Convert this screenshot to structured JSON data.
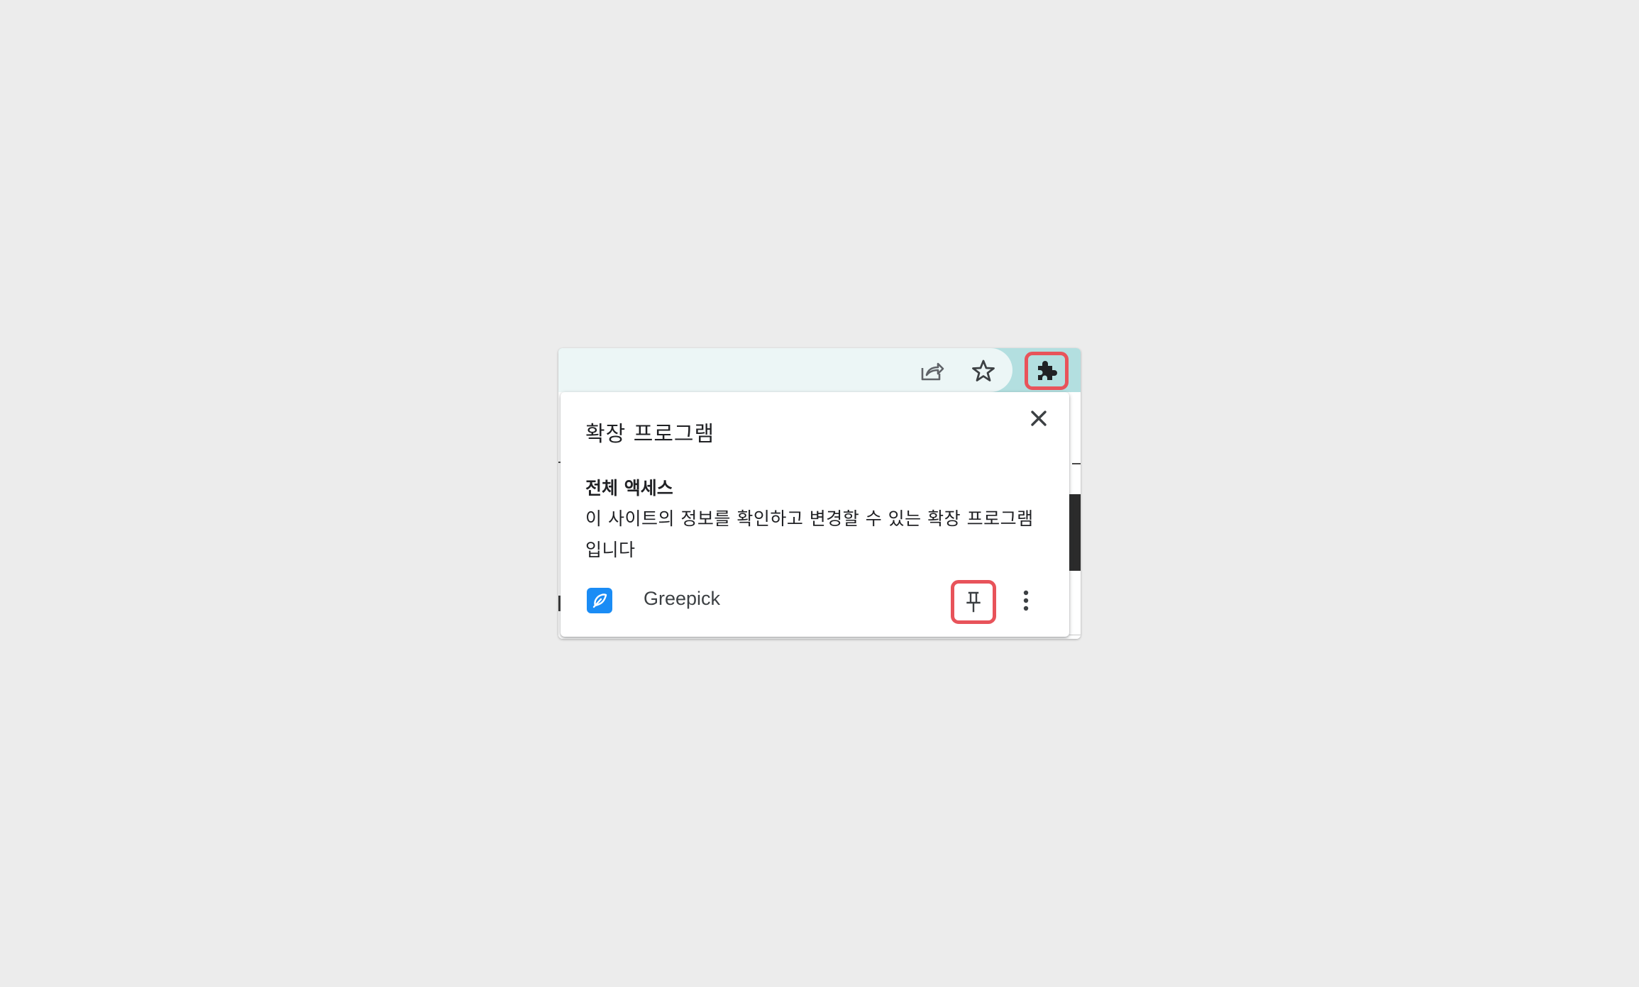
{
  "popup": {
    "title": "확장 프로그램",
    "section_title": "전체 액세스",
    "section_description": "이 사이트의 정보를 확인하고 변경할 수 있는 확장 프로그램입니다",
    "extensions": [
      {
        "name": "Greepick",
        "icon": "greepick-logo-icon",
        "icon_color": "#1a8cf5"
      }
    ]
  },
  "toolbar": {
    "icons": [
      "share-icon",
      "star-icon",
      "extensions-puzzle-icon"
    ]
  },
  "colors": {
    "highlight": "#e8535a",
    "toolbar_bg": "#b3dfe0",
    "omnibox_bg": "#ecf6f6",
    "page_bg": "#ececec"
  }
}
